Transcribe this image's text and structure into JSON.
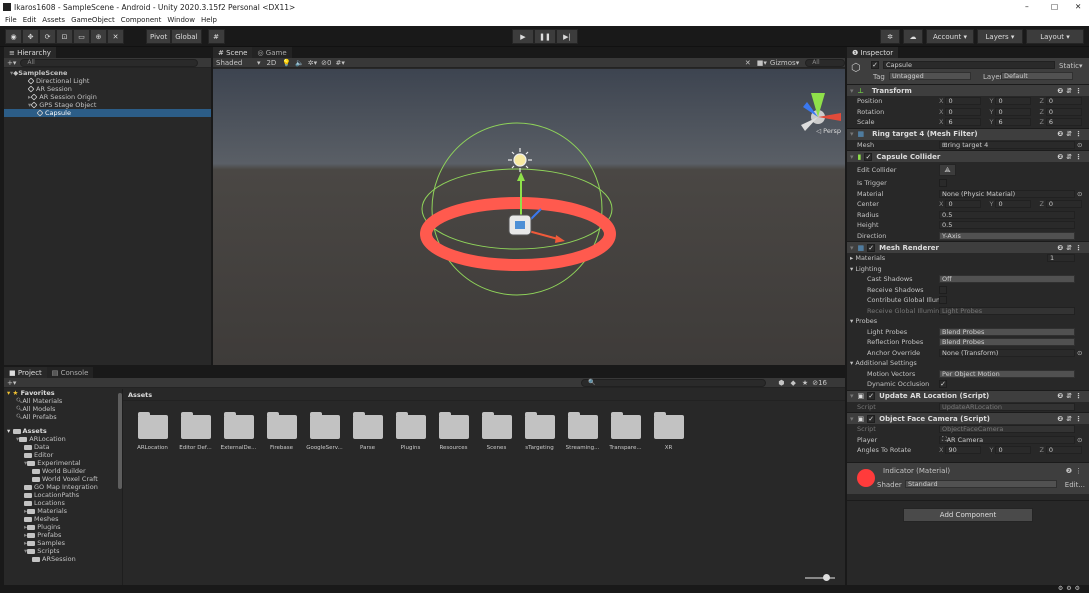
{
  "window": {
    "title": "Ikaros1608 - SampleScene - Android - Unity 2020.3.15f2 Personal <DX11>",
    "minimize": "–",
    "maximize": "□",
    "close": "✕"
  },
  "menu": [
    "File",
    "Edit",
    "Assets",
    "GameObject",
    "Component",
    "Window",
    "Help"
  ],
  "toolbar": {
    "pivot": "Pivot",
    "global": "Global",
    "account": "Account",
    "layers": "Layers",
    "layout": "Layout"
  },
  "hierarchy": {
    "tab": "Hierarchy",
    "search_placeholder": "All",
    "items": [
      {
        "label": "SampleScene",
        "indent": 0,
        "icon": "unity-scene-icon"
      },
      {
        "label": "Directional Light",
        "indent": 2,
        "icon": "gameobject-icon"
      },
      {
        "label": "AR Session",
        "indent": 2,
        "icon": "gameobject-icon"
      },
      {
        "label": "AR Session Origin",
        "indent": 2,
        "icon": "gameobject-icon"
      },
      {
        "label": "GPS Stage Object",
        "indent": 2,
        "icon": "gameobject-icon"
      },
      {
        "label": "Capsule",
        "indent": 3,
        "icon": "gameobject-icon",
        "selected": true
      }
    ]
  },
  "scene": {
    "tab_scene": "Scene",
    "tab_game": "Game",
    "shaded": "Shaded",
    "mode_2d": "2D",
    "gizmos": "Gizmos",
    "search_placeholder": "All",
    "persp": "◁ Persp",
    "fx_count": "0"
  },
  "project": {
    "tab_project": "Project",
    "tab_console": "Console",
    "count": "16",
    "favorites": "Favorites",
    "fav_items": [
      "All Materials",
      "All Models",
      "All Prefabs"
    ],
    "assets_label": "Assets",
    "tree": [
      {
        "label": "ARLocation",
        "indent": 1
      },
      {
        "label": "Data",
        "indent": 2
      },
      {
        "label": "Editor",
        "indent": 2
      },
      {
        "label": "Experimental",
        "indent": 2
      },
      {
        "label": "World Builder",
        "indent": 3
      },
      {
        "label": "World Voxel Craft",
        "indent": 3
      },
      {
        "label": "GO Map Integration",
        "indent": 2
      },
      {
        "label": "LocationPaths",
        "indent": 2
      },
      {
        "label": "Locations",
        "indent": 2
      },
      {
        "label": "Materials",
        "indent": 2
      },
      {
        "label": "Meshes",
        "indent": 2
      },
      {
        "label": "Plugins",
        "indent": 2
      },
      {
        "label": "Prefabs",
        "indent": 2
      },
      {
        "label": "Samples",
        "indent": 2
      },
      {
        "label": "Scripts",
        "indent": 2
      },
      {
        "label": "ARSession",
        "indent": 3
      }
    ],
    "folders": [
      "ARLocation",
      "Editor Def...",
      "ExternalDe...",
      "Firebase",
      "GoogleServ...",
      "Parse",
      "Plugins",
      "Resources",
      "Scenes",
      "sTargeting",
      "Streaming...",
      "Transpare...",
      "XR"
    ]
  },
  "inspector": {
    "tab": "Inspector",
    "object_name": "Capsule",
    "static": "Static",
    "tag_label": "Tag",
    "tag": "Untagged",
    "layer_label": "Layer",
    "layer": "Default",
    "transform": {
      "title": "Transform",
      "rows": [
        {
          "label": "Position",
          "x": "0",
          "y": "0",
          "z": "0"
        },
        {
          "label": "Rotation",
          "x": "0",
          "y": "0",
          "z": "0"
        },
        {
          "label": "Scale",
          "x": "6",
          "y": "6",
          "z": "6"
        }
      ]
    },
    "mesh_filter": {
      "title": "Ring target 4 (Mesh Filter)",
      "mesh_label": "Mesh",
      "mesh": "ring target 4"
    },
    "collider": {
      "title": "Capsule Collider",
      "edit": "Edit Collider",
      "is_trigger": "Is Trigger",
      "material_label": "Material",
      "material": "None (Physic Material)",
      "center_label": "Center",
      "cx": "0",
      "cy": "0",
      "cz": "0",
      "radius_label": "Radius",
      "radius": "0.5",
      "height_label": "Height",
      "height": "0.5",
      "direction_label": "Direction",
      "direction": "Y-Axis"
    },
    "renderer": {
      "title": "Mesh Renderer",
      "materials": "Materials",
      "materials_count": "1",
      "lighting": "Lighting",
      "cast_shadows": "Cast Shadows",
      "cast_value": "Off",
      "receive": "Receive Shadows",
      "contribute": "Contribute Global Illumina",
      "receive_gi": "Receive Global Illuminati",
      "receive_gi_value": "Light Probes",
      "probes": "Probes",
      "light_probes": "Light Probes",
      "light_probes_value": "Blend Probes",
      "reflection": "Reflection Probes",
      "reflection_value": "Blend Probes",
      "anchor": "Anchor Override",
      "anchor_value": "None (Transform)",
      "additional": "Additional Settings",
      "motion": "Motion Vectors",
      "motion_value": "Per Object Motion",
      "dynamic": "Dynamic Occlusion"
    },
    "update_ar": {
      "title": "Update AR Location (Script)",
      "script_label": "Script",
      "script": "UpdateARLocation"
    },
    "face_cam": {
      "title": "Object Face Camera (Script)",
      "script_label": "Script",
      "script": "ObjectFaceCamera",
      "player_label": "Player",
      "player": "AR Camera",
      "angles_label": "Angles To Rotate",
      "ax": "90",
      "ay": "0",
      "az": "0"
    },
    "material": {
      "name": "Indicator (Material)",
      "shader_label": "Shader",
      "shader": "Standard",
      "edit": "Edit..."
    },
    "add_component": "Add Component"
  },
  "colors": {
    "selection": "#2c5d87",
    "ring": "#ff5a4e",
    "material_swatch": "#ff3b3b"
  }
}
